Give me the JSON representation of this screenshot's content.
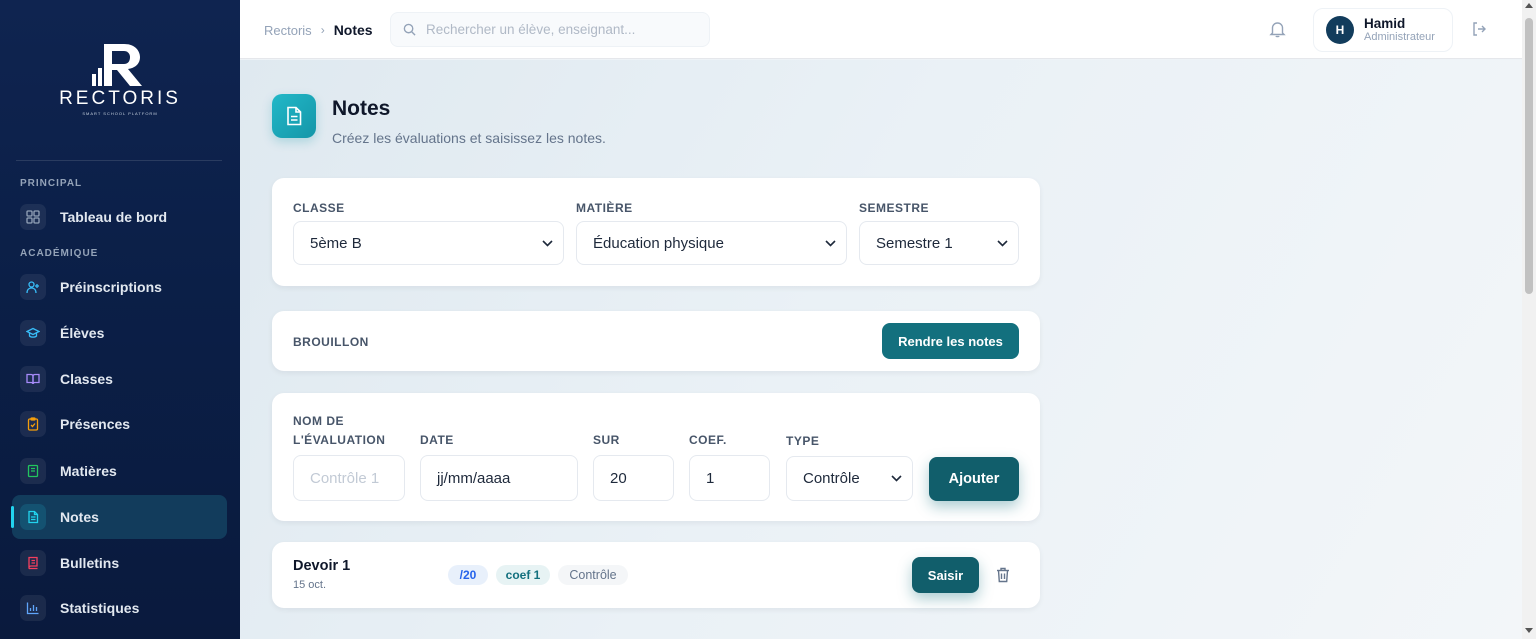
{
  "app": {
    "logo_text": "RECTORIS",
    "logo_tagline": "SMART SCHOOL PLATFORM"
  },
  "sidebar": {
    "sections": [
      {
        "label": "PRINCIPAL"
      },
      {
        "label": "ACADÉMIQUE"
      }
    ],
    "items": [
      {
        "label": "Tableau de bord",
        "icon": "dashboard-icon",
        "color": "#94a3b8"
      },
      {
        "label": "Préinscriptions",
        "icon": "user-plus-icon",
        "color": "#38bdf8"
      },
      {
        "label": "Élèves",
        "icon": "graduation-cap-icon",
        "color": "#38bdf8"
      },
      {
        "label": "Classes",
        "icon": "book-open-icon",
        "color": "#a78bfa"
      },
      {
        "label": "Présences",
        "icon": "clipboard-check-icon",
        "color": "#f59e0b"
      },
      {
        "label": "Matières",
        "icon": "book-icon",
        "color": "#22c55e"
      },
      {
        "label": "Notes",
        "icon": "file-text-icon",
        "color": "#22d3ee",
        "active": true
      },
      {
        "label": "Bulletins",
        "icon": "report-icon",
        "color": "#f43f5e"
      },
      {
        "label": "Statistiques",
        "icon": "bar-chart-icon",
        "color": "#60a5fa"
      }
    ]
  },
  "topbar": {
    "breadcrumb": [
      "Rectoris",
      "Notes"
    ],
    "search_placeholder": "Rechercher un élève, enseignant...",
    "user": {
      "initial": "H",
      "name": "Hamid",
      "role": "Administrateur"
    }
  },
  "page": {
    "title": "Notes",
    "subtitle": "Créez les évaluations et saisissez les notes."
  },
  "filters": {
    "classe": {
      "label": "CLASSE",
      "value": "5ème B"
    },
    "matiere": {
      "label": "MATIÈRE",
      "value": "Éducation physique"
    },
    "semestre": {
      "label": "SEMESTRE",
      "value": "Semestre 1"
    }
  },
  "status": {
    "label": "BROUILLON",
    "button": "Rendre les notes"
  },
  "new_eval": {
    "name_label_1": "NOM DE",
    "name_label_2": "L'ÉVALUATION",
    "name_placeholder": "Contrôle 1",
    "date_label": "DATE",
    "date_value": "jj/mm/aaaa",
    "sur_label": "SUR",
    "sur_value": "20",
    "coef_label": "COEF.",
    "coef_value": "1",
    "type_label": "TYPE",
    "type_value": "Contrôle",
    "add_button": "Ajouter"
  },
  "evaluations": [
    {
      "name": "Devoir 1",
      "date": "15 oct.",
      "sur": "/20",
      "coef": "coef 1",
      "type": "Contrôle",
      "action": "Saisir"
    }
  ],
  "colors": {
    "primary": "#13707e",
    "sidebar_bg": "#0b1f47",
    "accent": "#22d3ee"
  }
}
